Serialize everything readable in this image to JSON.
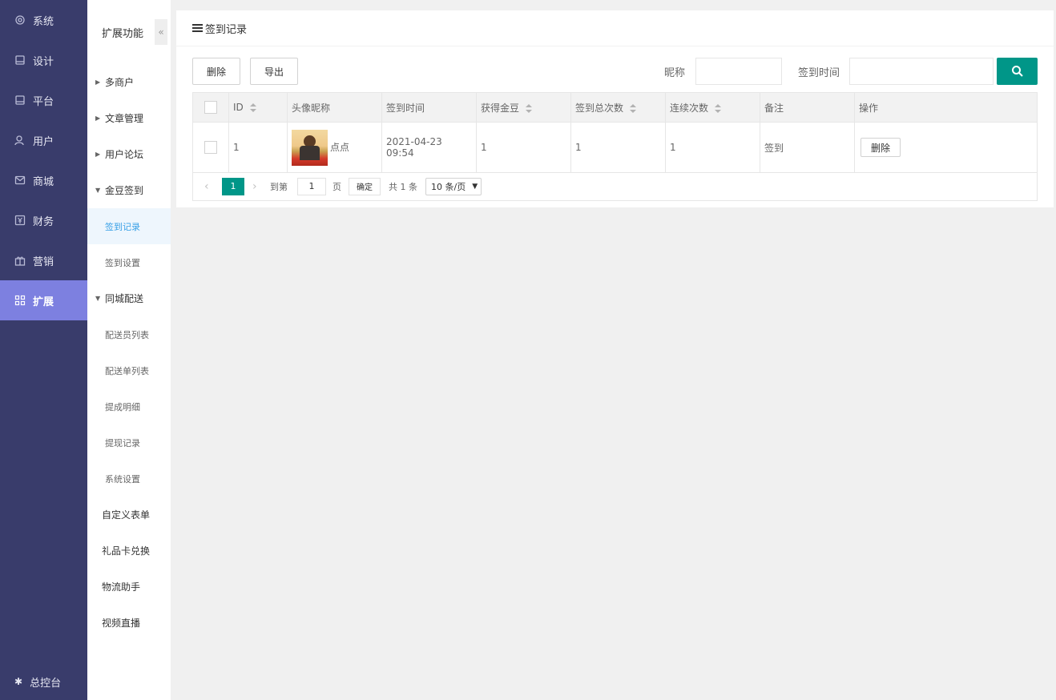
{
  "sidebar": {
    "items": [
      {
        "label": "系统",
        "icon": "gear-icon"
      },
      {
        "label": "设计",
        "icon": "monitor-icon"
      },
      {
        "label": "平台",
        "icon": "monitor-icon"
      },
      {
        "label": "用户",
        "icon": "user-icon"
      },
      {
        "label": "商城",
        "icon": "mail-icon"
      },
      {
        "label": "财务",
        "icon": "yen-icon"
      },
      {
        "label": "营销",
        "icon": "gift-icon"
      },
      {
        "label": "扩展",
        "icon": "grid-icon"
      }
    ],
    "active": "扩展",
    "bottom_label": "总控台"
  },
  "subnav": {
    "title": "扩展功能",
    "collapse_glyph": "«",
    "groups": {
      "merchant": "多商户",
      "article": "文章管理",
      "forum": "用户论坛",
      "checkin": "金豆签到",
      "checkin_records": "签到记录",
      "checkin_settings": "签到设置",
      "delivery": "同城配送",
      "courier_list": "配送员列表",
      "delivery_orders": "配送单列表",
      "commission": "提成明细",
      "withdraw": "提现记录",
      "sys_settings": "系统设置"
    },
    "top_items": [
      "自定义表单",
      "礼品卡兑换",
      "物流助手",
      "视频直播"
    ]
  },
  "panel": {
    "title": "签到记录",
    "delete_label": "删除",
    "export_label": "导出",
    "nickname_label": "昵称",
    "nickname_value": "",
    "checkin_time_label": "签到时间",
    "checkin_time_value": ""
  },
  "table": {
    "headers": [
      "ID",
      "头像昵称",
      "签到时间",
      "获得金豆",
      "签到总次数",
      "连续次数",
      "备注",
      "操作"
    ],
    "rows": [
      {
        "id": "1",
        "nickname": "点点",
        "time": "2021-04-23 09:54",
        "beans": "1",
        "total": "1",
        "streak": "1",
        "note": "签到",
        "action": "删除"
      }
    ]
  },
  "pager": {
    "current": "1",
    "goto_label": "到第",
    "goto_value": "1",
    "page_label": "页",
    "confirm_label": "确定",
    "total_label": "共 1 条",
    "page_size": "10 条/页"
  },
  "colors": {
    "sidebar_bg": "#393c6b",
    "sidebar_active": "#7d80e0",
    "primary": "#009688",
    "sub_active": "#38a0e6"
  }
}
